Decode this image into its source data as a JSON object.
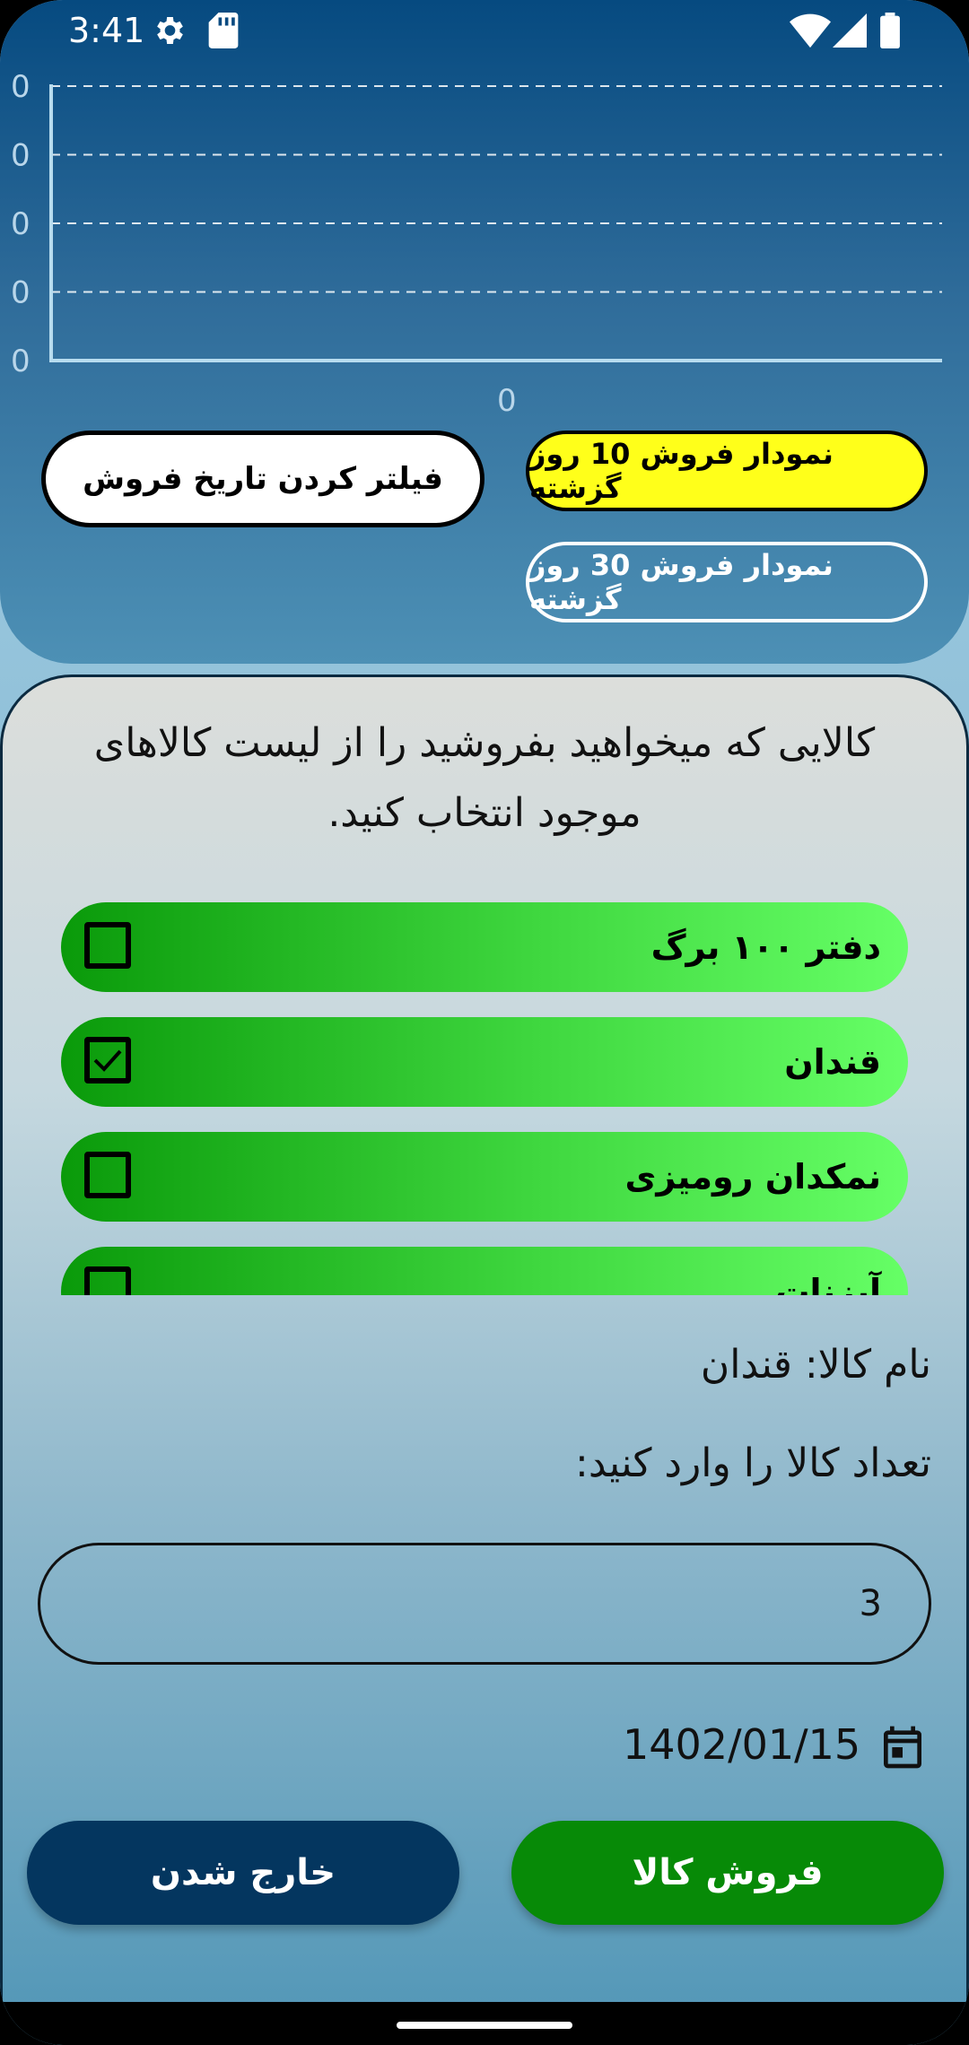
{
  "status_bar": {
    "time": "3:41",
    "icons": [
      "gear-icon",
      "sd-card-icon",
      "wifi-icon",
      "signal-icon",
      "battery-icon"
    ]
  },
  "chart_data": {
    "type": "line",
    "y_tick_labels": [
      "0",
      "0",
      "0",
      "0",
      "0"
    ],
    "x_tick_labels": [
      "0"
    ],
    "series": [],
    "grid": true,
    "grid_style": "dashed"
  },
  "chart_buttons": {
    "filter_label": "فیلتر کردن تاریخ فروش",
    "ten_days_label": "نمودار فروش 10 روز گزشته",
    "thirty_days_label": "نمودار فروش 30 روز گزشته"
  },
  "sell_panel": {
    "instruction": "کالایی که میخواهید بفروشید را از لیست کالاهای موجود انتخاب کنید.",
    "items": [
      {
        "label": "دفتر ۱۰۰ برگ",
        "checked": false
      },
      {
        "label": "قندان",
        "checked": true
      },
      {
        "label": "نمکدان رومیزی",
        "checked": false
      },
      {
        "label": "آبزنات",
        "checked": false
      }
    ],
    "product_name_line": "نام کالا: قندان",
    "quantity_prompt": "تعداد کالا را وارد کنید:",
    "quantity_value": "3",
    "date": "1402/01/15",
    "sell_button": "فروش کالا",
    "exit_button": "خارج شدن"
  },
  "colors": {
    "accent_yellow": "#ffff1a",
    "sell_green": "#078a07",
    "exit_navy": "#04365f",
    "item_green": "#3ed63e"
  }
}
